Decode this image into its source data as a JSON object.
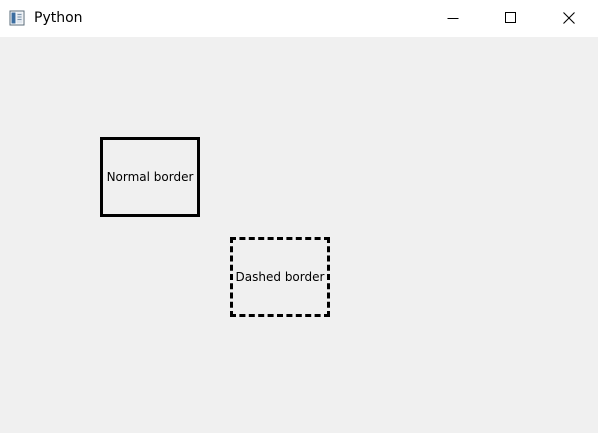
{
  "window": {
    "title": "Python",
    "icon": "python-window-icon",
    "controls": {
      "minimize": "minimize-icon",
      "maximize": "maximize-icon",
      "close": "close-icon"
    }
  },
  "labels": {
    "normal": {
      "text": "Normal border",
      "border_style": "solid",
      "border_color": "#000000"
    },
    "dashed": {
      "text": "Dashed border",
      "border_style": "dashed",
      "border_color": "#000000"
    }
  },
  "colors": {
    "titlebar_bg": "#ffffff",
    "client_bg": "#f0f0f0",
    "text": "#000000"
  }
}
